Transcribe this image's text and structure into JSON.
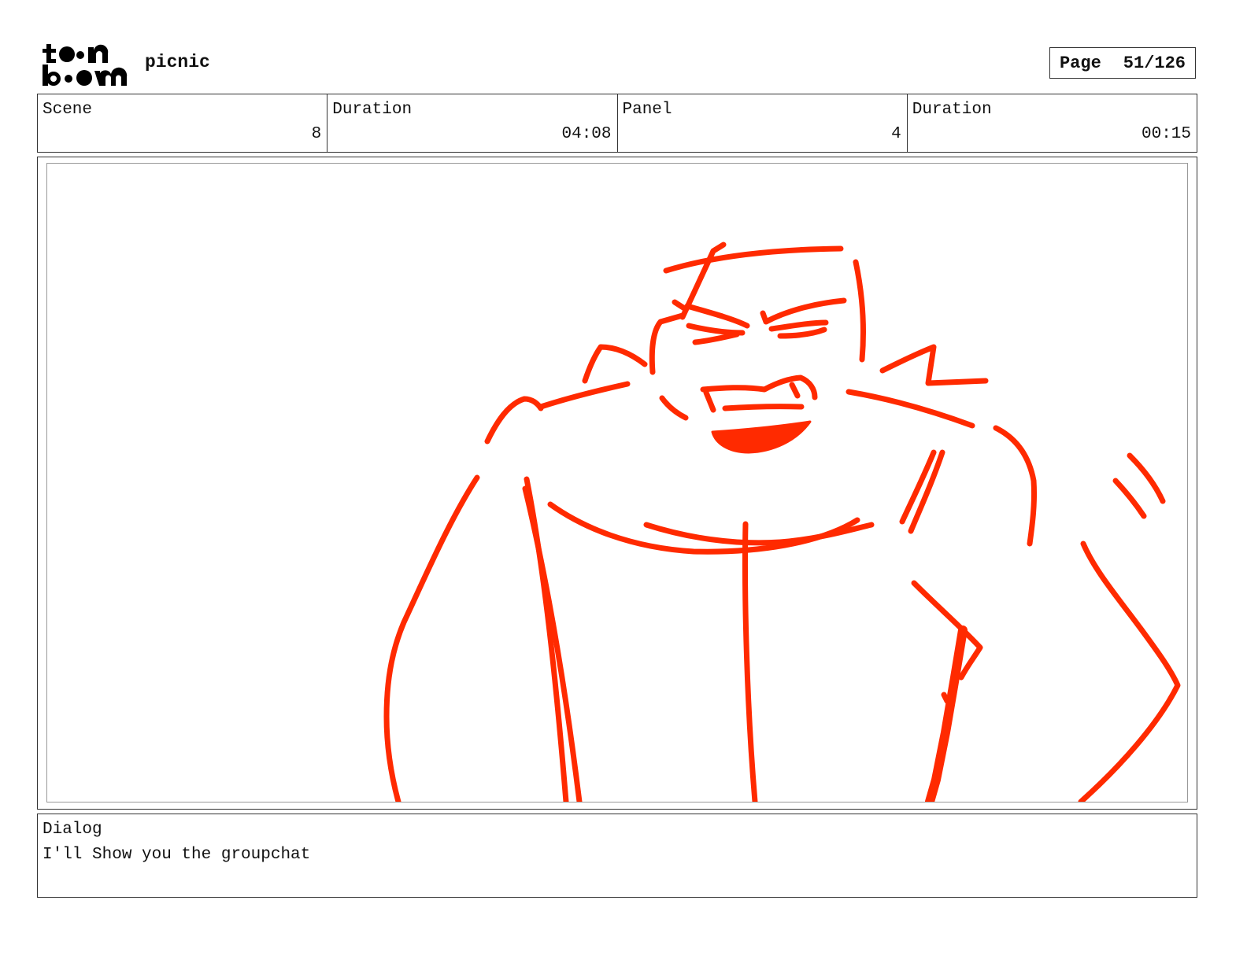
{
  "header": {
    "logo_text": "toonboom",
    "project_title": "picnic",
    "page_label": "Page",
    "page_number": "51/126"
  },
  "info": {
    "scene_label": "Scene",
    "scene_value": "8",
    "scene_duration_label": "Duration",
    "scene_duration_value": "04:08",
    "panel_label": "Panel",
    "panel_value": "4",
    "panel_duration_label": "Duration",
    "panel_duration_value": "00:15"
  },
  "dialog": {
    "label": "Dialog",
    "text": "I'll Show you the groupchat"
  },
  "colors": {
    "sketch_stroke": "#ff2a00",
    "frame_border": "#333333"
  }
}
